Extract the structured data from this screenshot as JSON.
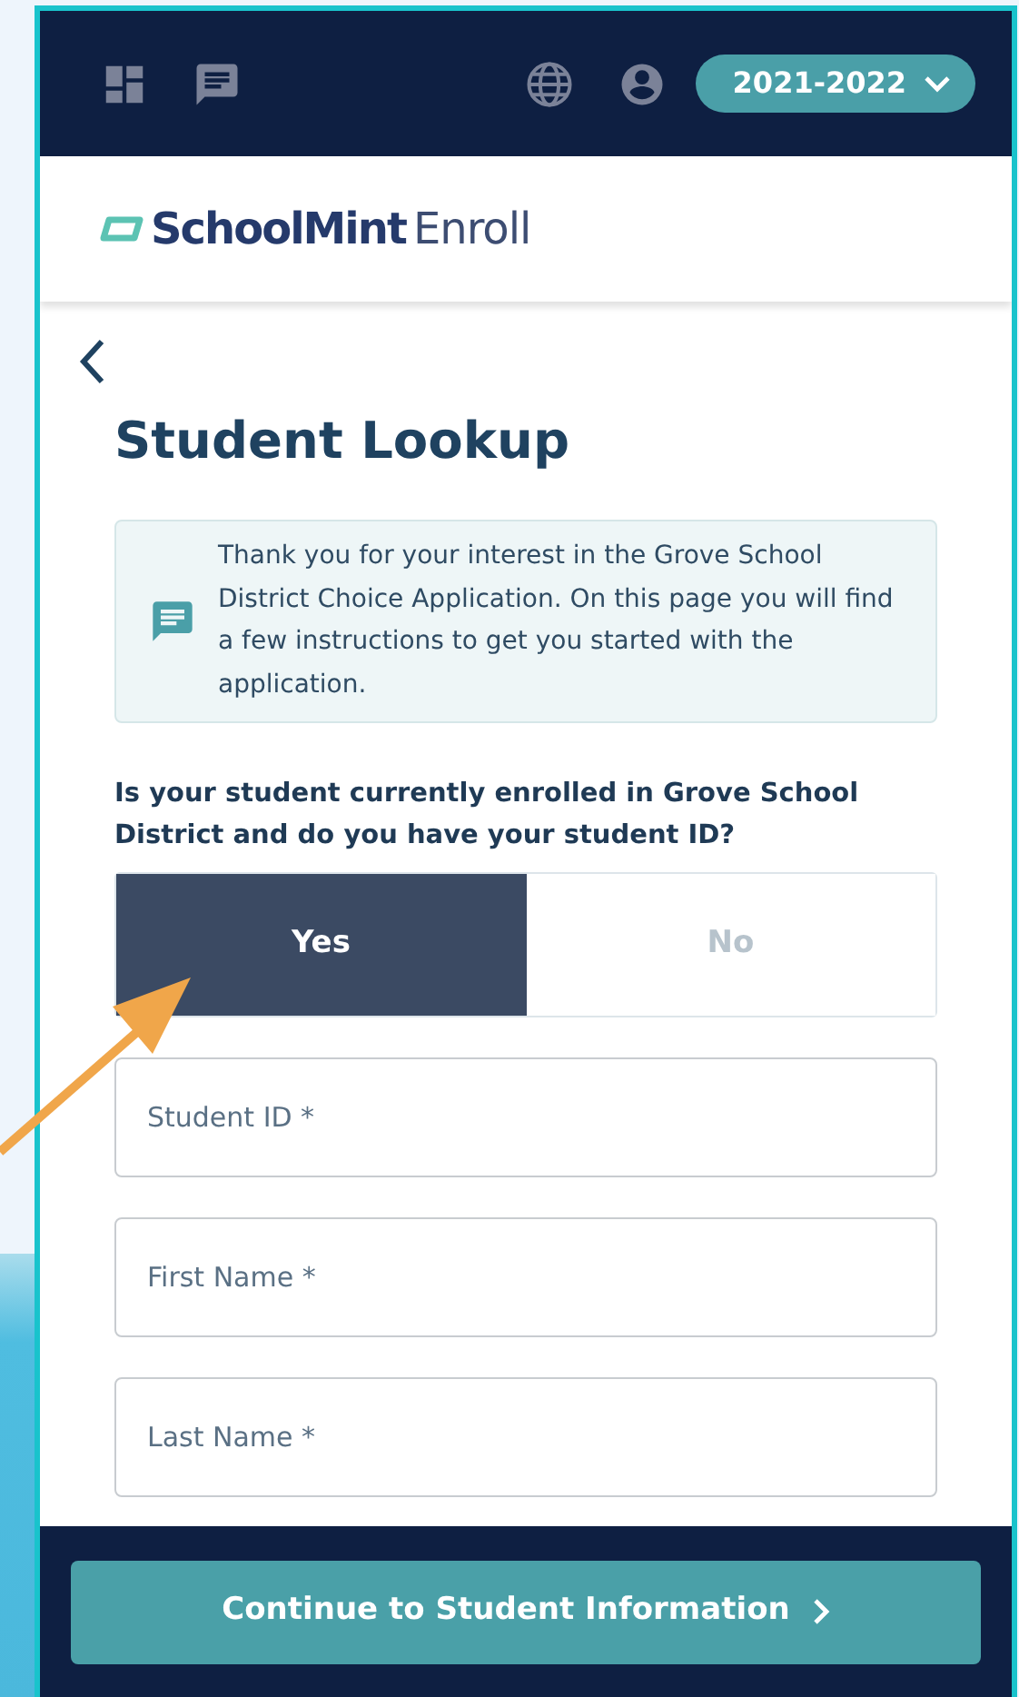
{
  "top_bar": {
    "year_selector": "2021-2022"
  },
  "logo": {
    "brand": "SchoolMint",
    "product": "Enroll"
  },
  "title": "Student Lookup",
  "info": "Thank you for your interest in the Grove School District Choice Application. On this page you will find a few instructions to get you started with the application.",
  "question": "Is your student currently enrolled in Grove School District and do you have your student ID?",
  "options": [
    {
      "label": "Yes",
      "selected": true
    },
    {
      "label": "No",
      "selected": false
    }
  ],
  "fields": [
    {
      "placeholder": "Student ID *"
    },
    {
      "placeholder": "First Name *"
    },
    {
      "placeholder": "Last Name *"
    }
  ],
  "continue_button": "Continue to Student Information"
}
